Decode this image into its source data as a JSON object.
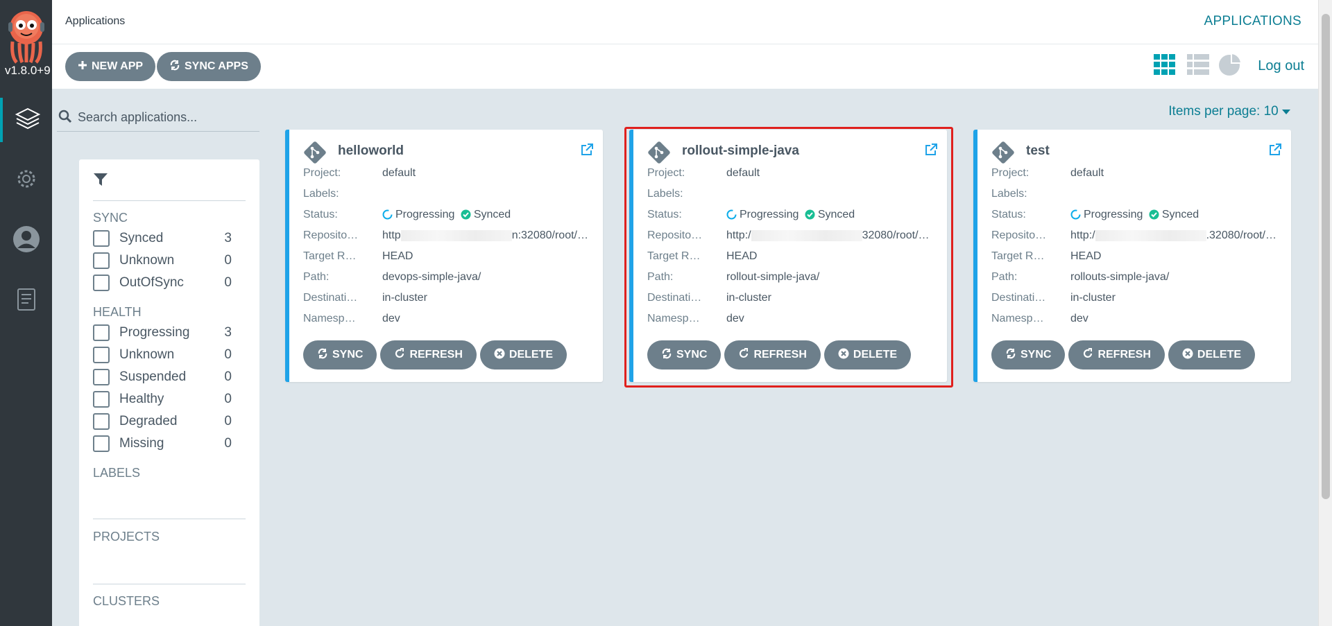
{
  "nav": {
    "version": "v1.8.0+9",
    "items": [
      "applications",
      "settings",
      "user-info",
      "documentation"
    ]
  },
  "topbar": {
    "breadcrumb": "Applications",
    "title": "APPLICATIONS"
  },
  "toolbar": {
    "new_app": "NEW APP",
    "sync_apps": "SYNC APPS",
    "logout": "Log out"
  },
  "search": {
    "placeholder": "Search applications..."
  },
  "pagination": {
    "items_per_page": "Items per page: 10"
  },
  "filters": {
    "sync_title": "SYNC",
    "sync": [
      {
        "label": "Synced",
        "count": "3"
      },
      {
        "label": "Unknown",
        "count": "0"
      },
      {
        "label": "OutOfSync",
        "count": "0"
      }
    ],
    "health_title": "HEALTH",
    "health": [
      {
        "label": "Progressing",
        "count": "3"
      },
      {
        "label": "Unknown",
        "count": "0"
      },
      {
        "label": "Suspended",
        "count": "0"
      },
      {
        "label": "Healthy",
        "count": "0"
      },
      {
        "label": "Degraded",
        "count": "0"
      },
      {
        "label": "Missing",
        "count": "0"
      }
    ],
    "labels_title": "LABELS",
    "projects_title": "PROJECTS",
    "clusters_title": "CLUSTERS"
  },
  "field_labels": {
    "project": "Project:",
    "labels": "Labels:",
    "status": "Status:",
    "repository": "Reposito…",
    "target": "Target R…",
    "path": "Path:",
    "destination": "Destinati…",
    "namespace": "Namesp…"
  },
  "card_actions": {
    "sync": "SYNC",
    "refresh": "REFRESH",
    "delete": "DELETE"
  },
  "apps": [
    {
      "name": "helloworld",
      "project": "default",
      "labels": "",
      "health": "Progressing",
      "sync": "Synced",
      "repo_prefix": "http",
      "repo_suffix": "n:32080/root/…",
      "target": "HEAD",
      "path": "devops-simple-java/",
      "destination": "in-cluster",
      "namespace": "dev"
    },
    {
      "name": "rollout-simple-java",
      "project": "default",
      "labels": "",
      "health": "Progressing",
      "sync": "Synced",
      "repo_prefix": "http:/",
      "repo_suffix": "32080/root/…",
      "target": "HEAD",
      "path": "rollout-simple-java/",
      "destination": "in-cluster",
      "namespace": "dev"
    },
    {
      "name": "test",
      "project": "default",
      "labels": "",
      "health": "Progressing",
      "sync": "Synced",
      "repo_prefix": "http:/",
      "repo_suffix": ".32080/root/…",
      "target": "HEAD",
      "path": "rollouts-simple-java/",
      "destination": "in-cluster",
      "namespace": "dev"
    }
  ],
  "colors": {
    "accent": "#0c7e93",
    "card_border": "#1fa3e8",
    "highlight": "#e0201d",
    "synced": "#18be94"
  }
}
